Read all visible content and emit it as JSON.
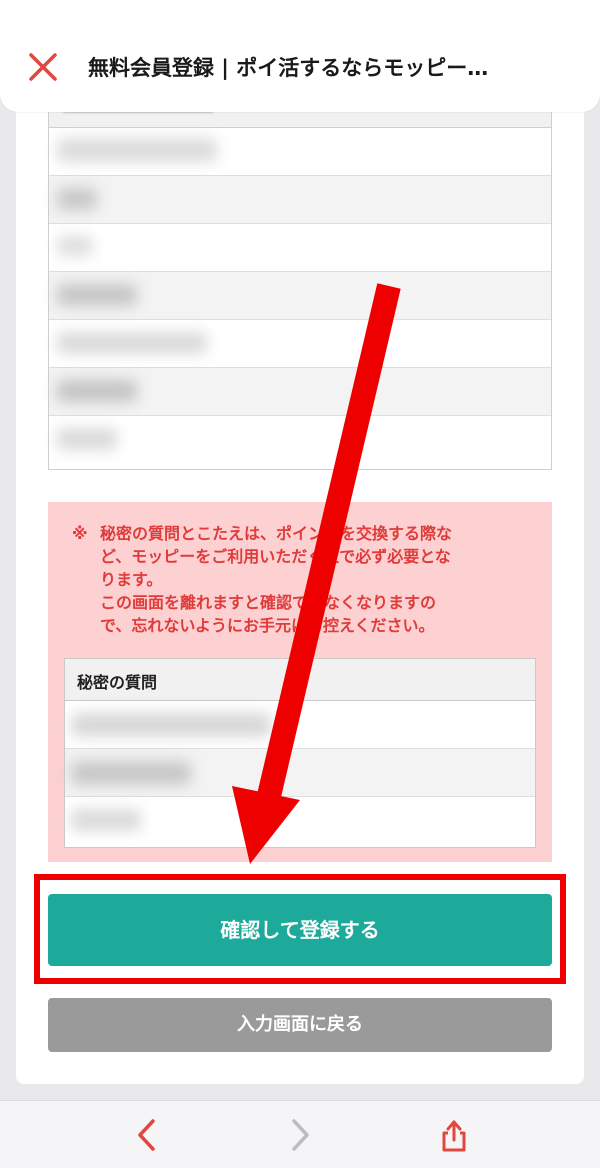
{
  "header": {
    "title": "無料会員登録 | ポイ活するならモッピー…",
    "close_icon": "close-icon"
  },
  "notice": {
    "mark": "※",
    "lines": [
      "秘密の質問とこたえは、ポイントを交換する際な",
      "ど、モッピーをご利用いただく上で必ず必要とな",
      "ります。",
      "この画面を離れますと確認できなくなりますの",
      "で、忘れないようにお手元にお控えください。"
    ]
  },
  "secret_table": {
    "header": "秘密の質問"
  },
  "buttons": {
    "confirm": "確認して登録する",
    "back": "入力画面に戻る"
  },
  "toolbar": {
    "back_icon": "chevron-left-icon",
    "forward_icon": "chevron-right-icon",
    "share_icon": "share-icon"
  },
  "colors": {
    "accent": "#1eaa9b",
    "notice_bg": "#fdd1d1",
    "notice_text": "#e03b3b",
    "annotation_red": "#ee0000"
  }
}
